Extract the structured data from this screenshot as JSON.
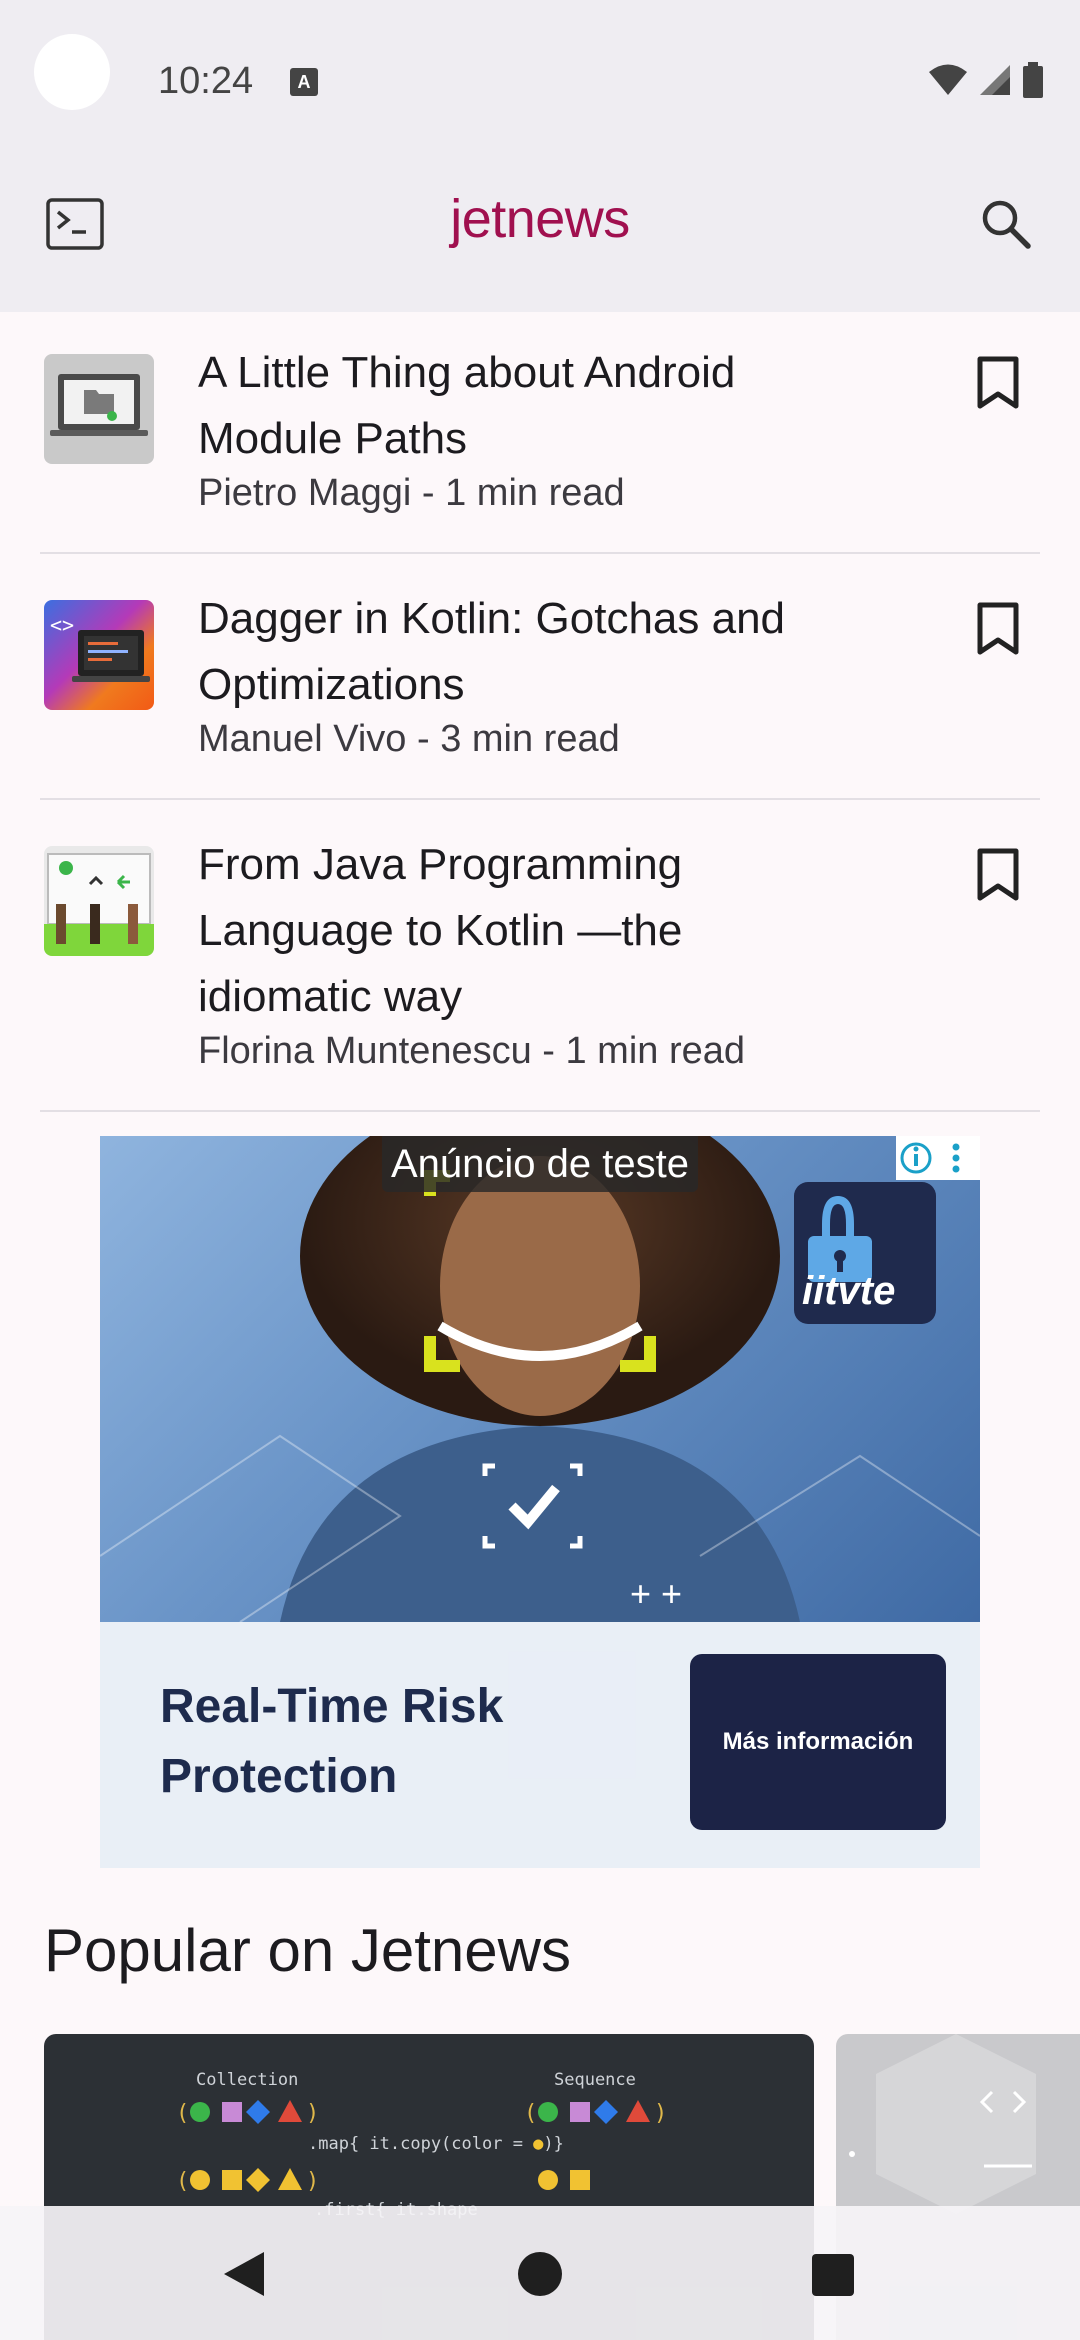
{
  "status_bar": {
    "time": "10:24",
    "notification_icon": "a-icon",
    "icons": [
      "wifi-icon",
      "signal-icon",
      "battery-icon"
    ]
  },
  "app_bar": {
    "title": "jetnews",
    "left_icon": "terminal-icon",
    "right_icon": "search-icon",
    "brand_color": "#a0104f"
  },
  "feed": {
    "posts": [
      {
        "title": "A Little Thing about Android Module Paths",
        "meta": "Pietro Maggi - 1 min read",
        "bookmark_icon": "bookmark-icon"
      },
      {
        "title": "Dagger in Kotlin: Gotchas and Optimizations",
        "meta": "Manuel Vivo - 3 min read",
        "bookmark_icon": "bookmark-icon"
      },
      {
        "title": "From Java Programming Language to Kotlin —the idiomatic way",
        "meta": "Florina Muntenescu - 1 min read",
        "bookmark_icon": "bookmark-icon"
      }
    ]
  },
  "ad": {
    "label": "Anúncio de teste",
    "logo_text": "iitvte",
    "headline": "Real-Time Risk Protection",
    "cta": "Más información"
  },
  "popular": {
    "heading": "Popular on Jetnews",
    "card1": {
      "left_label": "Collection",
      "right_label": "Sequence",
      "line1": ".map{ it.copy(color = ",
      "line1_end": ")}",
      "line2": ".first{ it.shape"
    }
  },
  "nav_bar": {
    "buttons": [
      "back-icon",
      "home-icon",
      "recents-icon"
    ]
  }
}
